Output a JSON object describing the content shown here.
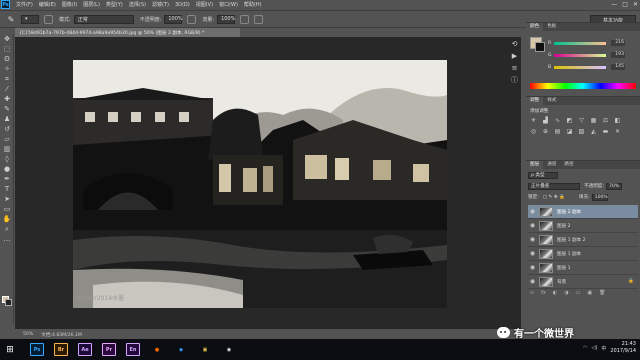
{
  "app": {
    "logo": "Ps",
    "menu": [
      "文件(F)",
      "编辑(E)",
      "图像(I)",
      "图层(L)",
      "类型(Y)",
      "选择(S)",
      "滤镜(T)",
      "3D(D)",
      "视图(V)",
      "窗口(W)",
      "帮助(H)"
    ],
    "window_buttons": [
      "—",
      "□",
      "✕"
    ]
  },
  "options_bar": {
    "tool_icon": "brush-icon",
    "mode_label": "模式:",
    "mode_value": "正常",
    "opacity_label": "不透明度:",
    "opacity_value": "100%",
    "flow_label": "流量:",
    "flow_value": "100%",
    "workspace": "基本功能"
  },
  "document": {
    "tab_title": "{C}58d91b7a-797b-484d-9974-a98a9a954b30.jpg @ 50% (图层 2 副本, RGB/8) *",
    "photo_watermark": "©river2014水墨",
    "zoom": "50%",
    "doc_info": "文档:4.83M/26.1M"
  },
  "panels": {
    "color": {
      "tabs": [
        "颜色",
        "色板"
      ],
      "r": 216,
      "g": 193,
      "b": 145,
      "fg_color": "#d8c191",
      "bg_color": "#111111"
    },
    "adjustments": {
      "tabs": [
        "调整",
        "样式"
      ],
      "title": "添加调整",
      "icons": [
        "brightness-icon",
        "levels-icon",
        "curves-icon",
        "exposure-icon",
        "vibrance-icon",
        "hue-sat-icon",
        "color-balance-icon",
        "bw-icon",
        "photo-filter-icon",
        "channel-mixer-icon",
        "color-lookup-icon",
        "invert-icon",
        "posterize-icon",
        "threshold-icon",
        "gradient-map-icon",
        "selective-color-icon"
      ]
    },
    "layers": {
      "tabs": [
        "图层",
        "通道",
        "路径"
      ],
      "filter_label": "ρ 类型",
      "blend_mode": "正片叠底",
      "opacity_label": "不透明度:",
      "opacity_value": "70%",
      "lock_label": "锁定:",
      "fill_label": "填充:",
      "fill_value": "100%",
      "items": [
        {
          "name": "图层 2 副本",
          "active": true
        },
        {
          "name": "图层 2",
          "active": false
        },
        {
          "name": "图层 1 副本 2",
          "active": false
        },
        {
          "name": "图层 1 副本",
          "active": false
        },
        {
          "name": "图层 1",
          "active": false
        },
        {
          "name": "背景",
          "active": false
        }
      ],
      "footer_icons": [
        "∞",
        "fx",
        "◐",
        "◑",
        "▭",
        "▣",
        "🗑"
      ]
    }
  },
  "taskbar": {
    "apps": [
      {
        "label": "Ps",
        "color": "#31a8ff",
        "bg": "#001d34"
      },
      {
        "label": "Br",
        "color": "#f9b44c",
        "bg": "#2d1a00"
      },
      {
        "label": "Ae",
        "color": "#d4a3ff",
        "bg": "#1d0a3a"
      },
      {
        "label": "Pr",
        "color": "#e7a6ff",
        "bg": "#2a0a3a"
      },
      {
        "label": "En",
        "color": "#d3a8ff",
        "bg": "#24083a"
      },
      {
        "label": "●",
        "color": "#ff6a00",
        "bg": "#0b0d12"
      },
      {
        "label": "◆",
        "color": "#2c9cff",
        "bg": "#0b0d12"
      },
      {
        "label": "▣",
        "color": "#e8c44a",
        "bg": "#0b0d12"
      },
      {
        "label": "◉",
        "color": "#e8e8e8",
        "bg": "#0b0d12"
      }
    ],
    "ime": "中",
    "time": "21:43",
    "date": "2017/9/14"
  },
  "overlay": {
    "wechat_text": "有一个微世界"
  }
}
